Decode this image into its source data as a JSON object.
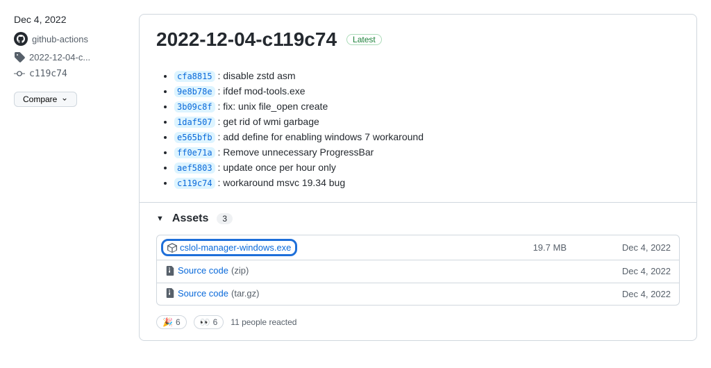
{
  "sidebar": {
    "date": "Dec 4, 2022",
    "actor": "github-actions",
    "tag": "2022-12-04-c...",
    "commit_short": "c119c74",
    "compare_label": "Compare"
  },
  "release": {
    "title": "2022-12-04-c119c74",
    "badge": "Latest"
  },
  "commits": [
    {
      "sha": "cfa8815",
      "msg": "disable zstd asm"
    },
    {
      "sha": "9e8b78e",
      "msg": "ifdef mod-tools.exe"
    },
    {
      "sha": "3b09c8f",
      "msg": "fix: unix file_open create"
    },
    {
      "sha": "1daf507",
      "msg": "get rid of wmi garbage"
    },
    {
      "sha": "e565bfb",
      "msg": "add define for enabling windows 7 workaround"
    },
    {
      "sha": "ff0e71a",
      "msg": "Remove unnecessary ProgressBar"
    },
    {
      "sha": "aef5803",
      "msg": "update once per hour only"
    },
    {
      "sha": "c119c74",
      "msg": "workaround msvc 19.34 bug"
    }
  ],
  "assets": {
    "heading": "Assets",
    "count": "3",
    "items": [
      {
        "name": "cslol-manager-windows.exe",
        "paren": "",
        "size": "19.7 MB",
        "date": "Dec 4, 2022",
        "highlight": true,
        "icon": "package"
      },
      {
        "name": "Source code",
        "paren": "(zip)",
        "size": "",
        "date": "Dec 4, 2022",
        "highlight": false,
        "icon": "zip"
      },
      {
        "name": "Source code",
        "paren": "(tar.gz)",
        "size": "",
        "date": "Dec 4, 2022",
        "highlight": false,
        "icon": "zip"
      }
    ]
  },
  "reactions": {
    "rocket": {
      "emoji": "🎉",
      "count": "6"
    },
    "eyes": {
      "emoji": "👀",
      "count": "6"
    },
    "summary": "11 people reacted"
  }
}
